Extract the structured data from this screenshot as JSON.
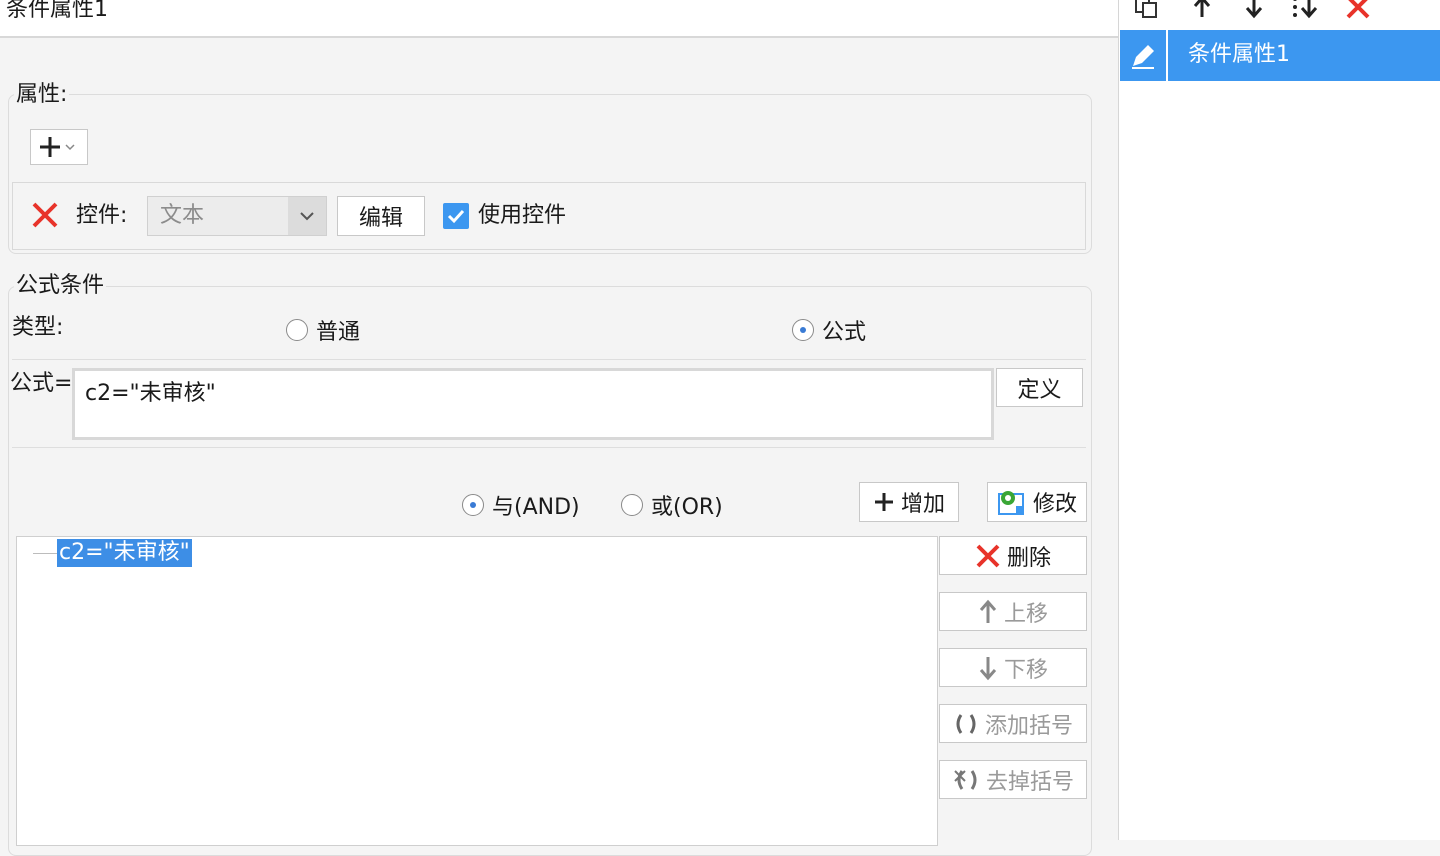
{
  "window": {
    "title": "条件属性1"
  },
  "properties": {
    "label": "属性:",
    "add_symbol": "+",
    "control_label": "控件:",
    "control_value": "文本",
    "edit_label": "编辑",
    "use_control_label": "使用控件",
    "use_control_checked": true
  },
  "formula_condition": {
    "group_label": "公式条件",
    "type_label": "类型:",
    "type_options": [
      "普通",
      "公式"
    ],
    "type_selected": "公式",
    "formula_label": "公式=",
    "formula_value": "c2=\"未审核\"",
    "define_label": "定义"
  },
  "logic": {
    "and_label": "与(AND)",
    "or_label": "或(OR)",
    "selected": "与(AND)",
    "add_label": "增加",
    "modify_label": "修改"
  },
  "condition_tree": {
    "items": [
      "c2=\"未审核\""
    ]
  },
  "side_buttons": {
    "delete": "删除",
    "move_up": "上移",
    "move_down": "下移",
    "add_bracket": "添加括号",
    "remove_bracket": "去掉括号"
  },
  "right_panel": {
    "items": [
      {
        "label": "条件属性1",
        "selected": true
      }
    ]
  },
  "colors": {
    "accent": "#3c97f0",
    "delete_red": "#e8332a",
    "selection_blue": "#3d8ee6",
    "green_icon": "#3aa635"
  }
}
